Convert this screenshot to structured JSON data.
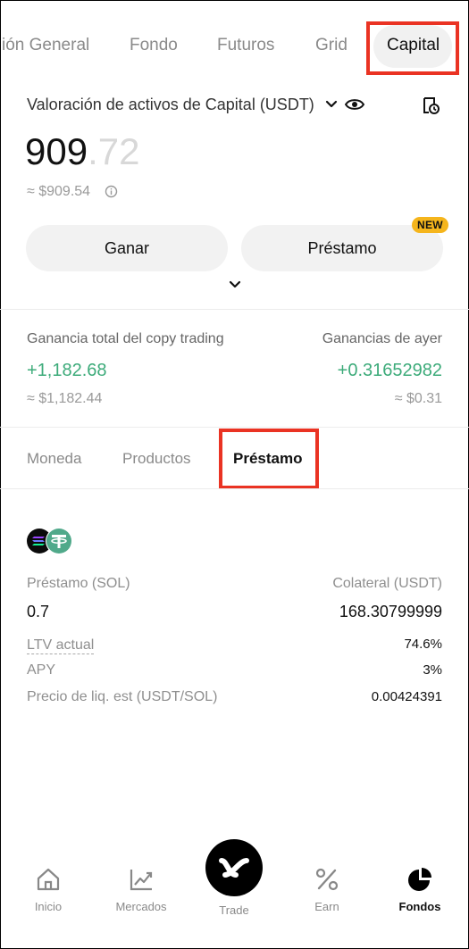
{
  "top_tabs": [
    {
      "label": "ión General"
    },
    {
      "label": "Fondo"
    },
    {
      "label": "Futuros"
    },
    {
      "label": "Grid"
    },
    {
      "label": "Capital"
    }
  ],
  "valuation": {
    "title": "Valoración de activos de Capital (USDT)",
    "amount_int": "909",
    "amount_dec": ".72",
    "fiat": "≈ $909.54"
  },
  "actions": {
    "earn_label": "Ganar",
    "loan_label": "Préstamo",
    "new_badge": "NEW"
  },
  "copy": {
    "total_label": "Ganancia total del copy trading",
    "total_value": "+1,182.68",
    "total_fiat": "≈ $1,182.44",
    "yesterday_label": "Ganancias de ayer",
    "yesterday_value": "+0.31652982",
    "yesterday_fiat": "≈ $0.31"
  },
  "sub_tabs": [
    {
      "label": "Moneda"
    },
    {
      "label": "Productos"
    },
    {
      "label": "Préstamo"
    }
  ],
  "loan": {
    "loan_label": "Préstamo (SOL)",
    "loan_value": "0.7",
    "collateral_label": "Colateral (USDT)",
    "collateral_value": "168.30799999",
    "ltv_label": "LTV actual",
    "ltv_value": "74.6%",
    "apy_label": "APY",
    "apy_value": "3%",
    "liq_label": "Precio de liq. est (USDT/SOL)",
    "liq_value": "0.00424391"
  },
  "nav": [
    {
      "label": "Inicio",
      "icon": "home-icon"
    },
    {
      "label": "Mercados",
      "icon": "chart-icon"
    },
    {
      "label": "Trade",
      "icon": "trade-icon"
    },
    {
      "label": "Earn",
      "icon": "percent-icon"
    },
    {
      "label": "Fondos",
      "icon": "pie-icon"
    }
  ],
  "colors": {
    "accent_green": "#3dab7a",
    "highlight_red": "#ea3323",
    "badge_yellow": "#f5b51c"
  }
}
